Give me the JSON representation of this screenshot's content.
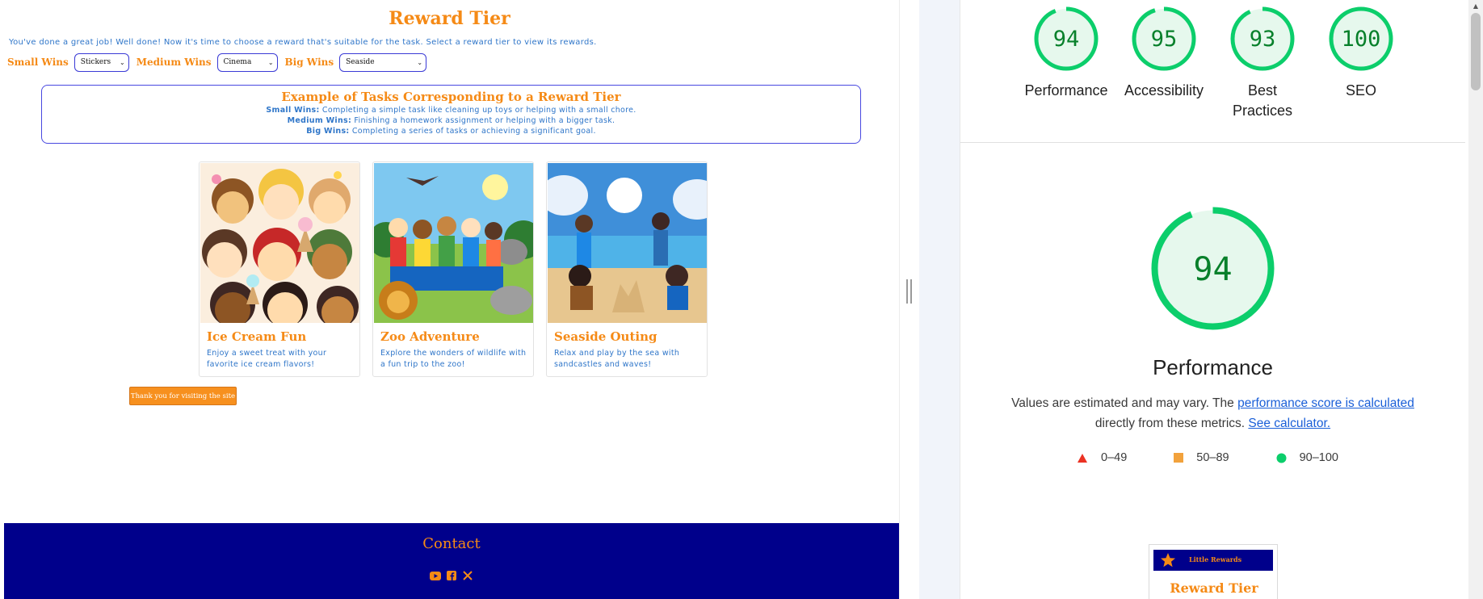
{
  "site": {
    "title": "Reward Tier",
    "intro": "You've done a great job! Well done! Now it's time to choose a reward that's suitable for the task. Select a reward tier to view its rewards.",
    "selectors": [
      {
        "label": "Small Wins",
        "value": "Stickers"
      },
      {
        "label": "Medium Wins",
        "value": "Cinema"
      },
      {
        "label": "Big Wins",
        "value": "Seaside"
      }
    ],
    "examples": {
      "title": "Example of Tasks Corresponding to a Reward Tier",
      "lines": [
        {
          "tier": "Small Wins:",
          "text": " Completing a simple task like cleaning up toys or helping with a small chore."
        },
        {
          "tier": "Medium Wins:",
          "text": " Finishing a homework assignment or helping with a bigger task."
        },
        {
          "tier": "Big Wins:",
          "text": " Completing a series of tasks or achieving a significant goal."
        }
      ]
    },
    "cards": [
      {
        "title": "Ice Cream Fun",
        "desc": "Enjoy a sweet treat with your favorite ice cream flavors!"
      },
      {
        "title": "Zoo Adventure",
        "desc": "Explore the wonders of wildlife with a fun trip to the zoo!"
      },
      {
        "title": "Seaside Outing",
        "desc": "Relax and play by the sea with sandcastles and waves!"
      }
    ],
    "thanks_button": "Thank you for visiting the site",
    "footer": {
      "contact_title": "Contact",
      "social_icons": [
        "youtube-icon",
        "facebook-icon",
        "x-icon"
      ]
    }
  },
  "lighthouse": {
    "scores": [
      {
        "label": "Performance",
        "score": "94",
        "fraction": 0.94
      },
      {
        "label": "Accessibility",
        "score": "95",
        "fraction": 0.95
      },
      {
        "label": "Best Practices",
        "score": "93",
        "fraction": 0.93
      },
      {
        "label": "SEO",
        "score": "100",
        "fraction": 1.0
      }
    ],
    "main": {
      "score": "94",
      "fraction": 0.94,
      "title": "Performance",
      "desc_prefix": "Values are estimated and may vary. The ",
      "desc_link1": "performance score is calculated",
      "desc_middle": "directly from these metrics. ",
      "desc_link2": "See calculator."
    },
    "legend": [
      {
        "range": "0–49",
        "shape": "triangle",
        "color": "#eb3223"
      },
      {
        "range": "50–89",
        "shape": "square",
        "color": "#f2a23c"
      },
      {
        "range": "90–100",
        "shape": "circle",
        "color": "#0cce6b"
      }
    ],
    "thumbnail": {
      "brand": "Little Rewards",
      "title": "Reward Tier"
    },
    "colors": {
      "pass": "#0cce6b",
      "pass_bg": "#e6f8ed",
      "pass_text": "#08802b"
    }
  }
}
